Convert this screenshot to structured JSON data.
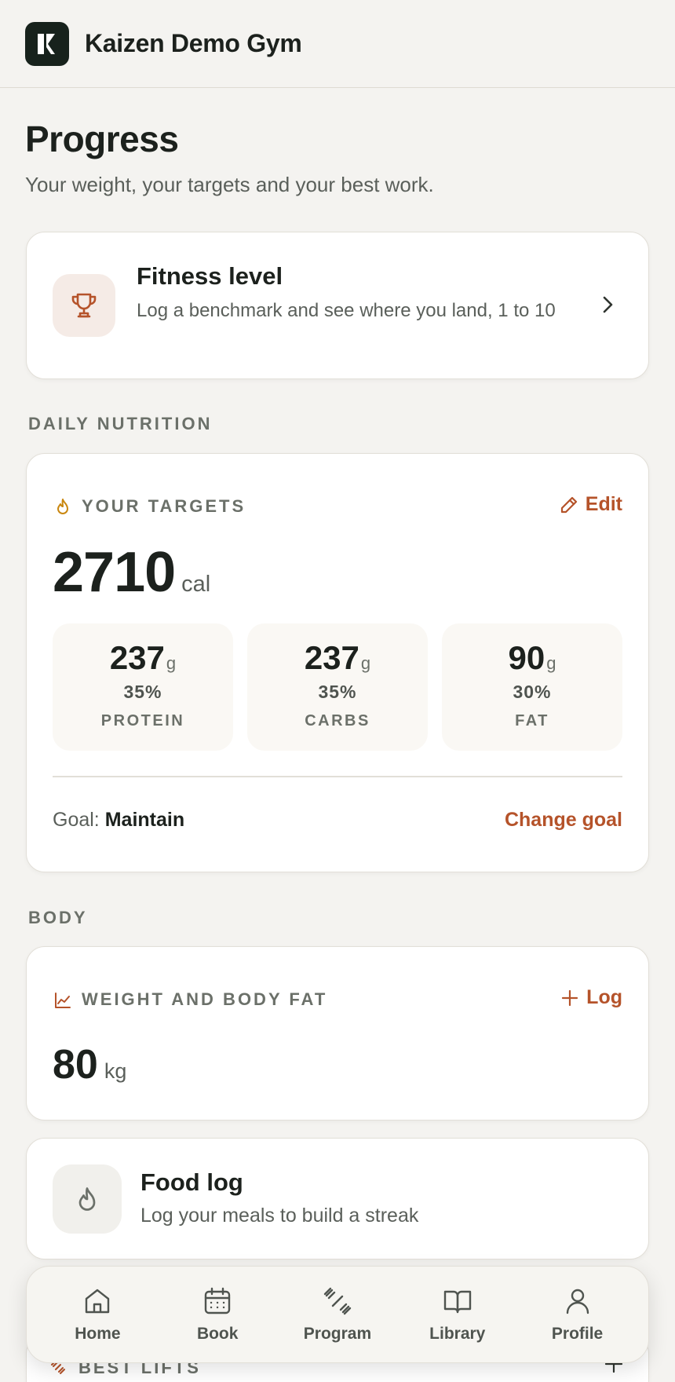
{
  "header": {
    "gym_name": "Kaizen Demo Gym",
    "logo_icon": "kaizen-logo"
  },
  "page": {
    "title": "Progress",
    "subtitle": "Your weight, your targets and your best work."
  },
  "fitness": {
    "title": "Fitness level",
    "description": "Log a benchmark and see where you land, 1 to 10",
    "icon": "trophy-icon"
  },
  "nutrition": {
    "section_label": "DAILY NUTRITION",
    "card_label": "YOUR TARGETS",
    "edit_label": "Edit",
    "calories": "2710",
    "calories_unit": "cal",
    "macros": [
      {
        "value": "237",
        "unit": "g",
        "percent": "35%",
        "name": "PROTEIN"
      },
      {
        "value": "237",
        "unit": "g",
        "percent": "35%",
        "name": "CARBS"
      },
      {
        "value": "90",
        "unit": "g",
        "percent": "30%",
        "name": "FAT"
      }
    ],
    "goal_prefix": "Goal:",
    "goal_value": "Maintain",
    "change_goal_label": "Change goal"
  },
  "body": {
    "section_label": "BODY",
    "card_label": "WEIGHT AND BODY FAT",
    "log_label": "Log",
    "weight": "80",
    "weight_unit": "kg"
  },
  "food_log": {
    "title": "Food log",
    "description": "Log your meals to build a streak"
  },
  "best_lifts": {
    "label": "BEST LIFTS"
  },
  "nav": {
    "items": [
      {
        "label": "Home",
        "icon": "home-icon"
      },
      {
        "label": "Book",
        "icon": "calendar-icon"
      },
      {
        "label": "Program",
        "icon": "dumbbell-icon"
      },
      {
        "label": "Library",
        "icon": "book-icon"
      },
      {
        "label": "Profile",
        "icon": "user-icon"
      }
    ]
  },
  "colors": {
    "accent": "#b5532a",
    "background": "#f4f3f0",
    "card": "#ffffff",
    "logo_bg": "#17221c"
  }
}
